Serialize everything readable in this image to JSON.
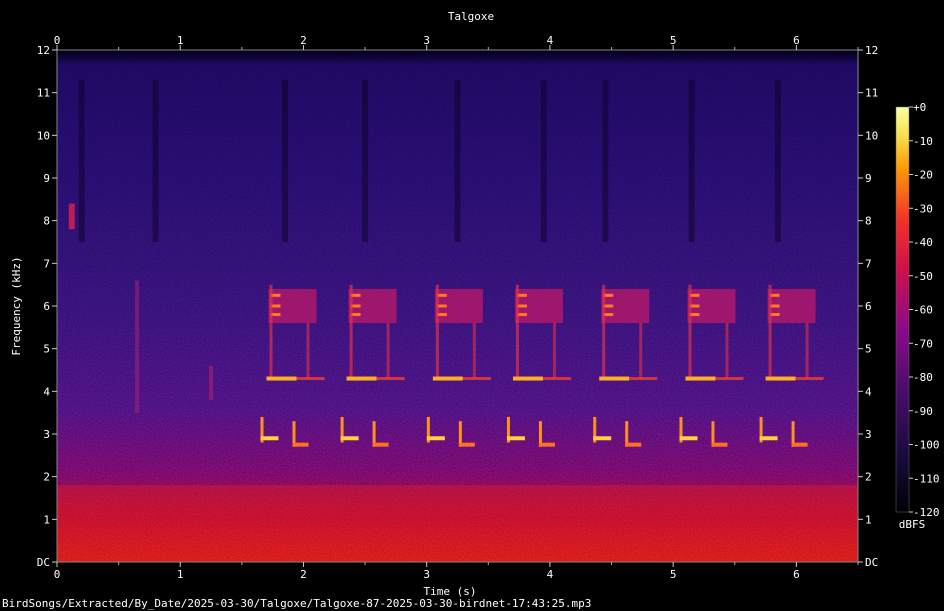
{
  "chart_data": {
    "type": "heatmap",
    "title": "Talgoxe",
    "xlabel": "Time (s)",
    "ylabel": "Frequency (kHz)",
    "x_ticks": [
      "0",
      "1",
      "2",
      "3",
      "4",
      "5",
      "6"
    ],
    "x_range": [
      0,
      6.5
    ],
    "y_ticks": [
      "DC",
      "1",
      "2",
      "3",
      "4",
      "5",
      "6",
      "7",
      "8",
      "9",
      "10",
      "11",
      "12"
    ],
    "y_range": [
      0,
      12
    ],
    "colorbar": {
      "label": "dBFS",
      "ticks": [
        "+0",
        "-10",
        "-20",
        "-30",
        "-40",
        "-50",
        "-60",
        "-70",
        "-80",
        "-90",
        "-100",
        "-110",
        "-120"
      ],
      "range": [
        -120,
        0
      ],
      "colormap": "magma"
    },
    "song_motifs": [
      {
        "t": 1.7
      },
      {
        "t": 2.35
      },
      {
        "t": 3.05
      },
      {
        "t": 3.7
      },
      {
        "t": 4.4
      },
      {
        "t": 5.1
      },
      {
        "t": 5.75
      }
    ],
    "tone_bands_khz": [
      4.3,
      2.9,
      6.0
    ],
    "footer": "BirdSongs/Extracted/By_Date/2025-03-30/Talgoxe/Talgoxe-87-2025-03-30-birdnet-17:43:25.mp3"
  }
}
